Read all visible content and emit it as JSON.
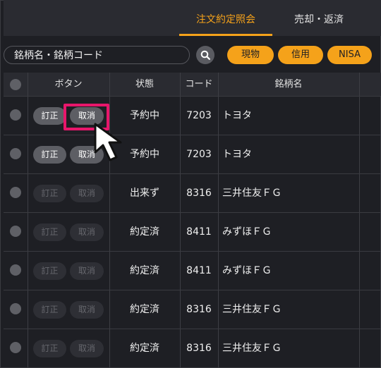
{
  "tabs": [
    {
      "label": "注文約定照会",
      "active": true
    },
    {
      "label": "売却・返済",
      "active": false
    }
  ],
  "search": {
    "value": "銘柄名・銘柄コード"
  },
  "filters": [
    "現物",
    "信用",
    "NISA"
  ],
  "columns": {
    "button": "ボタン",
    "status": "状態",
    "code": "コード",
    "name": "銘柄名"
  },
  "rows": [
    {
      "amend": "訂正",
      "cancel": "取消",
      "status": "予約中",
      "code": "7203",
      "name": "トヨタ",
      "enabled": true
    },
    {
      "amend": "訂正",
      "cancel": "取消",
      "status": "予約中",
      "code": "7203",
      "name": "トヨタ",
      "enabled": true
    },
    {
      "amend": "訂正",
      "cancel": "取消",
      "status": "出来ず",
      "code": "8316",
      "name": "三井住友ＦＧ",
      "enabled": false
    },
    {
      "amend": "訂正",
      "cancel": "取消",
      "status": "約定済",
      "code": "8411",
      "name": "みずほＦＧ",
      "enabled": false
    },
    {
      "amend": "訂正",
      "cancel": "取消",
      "status": "約定済",
      "code": "8411",
      "name": "みずほＦＧ",
      "enabled": false
    },
    {
      "amend": "訂正",
      "cancel": "取消",
      "status": "約定済",
      "code": "8316",
      "name": "三井住友ＦＧ",
      "enabled": false
    },
    {
      "amend": "訂正",
      "cancel": "取消",
      "status": "約定済",
      "code": "8316",
      "name": "三井住友ＦＧ",
      "enabled": false
    }
  ],
  "colors": {
    "accent": "#f5a21a",
    "highlight": "#e8166b"
  },
  "icons": {
    "search": "search-icon",
    "cursor": "mouse-pointer-icon"
  }
}
